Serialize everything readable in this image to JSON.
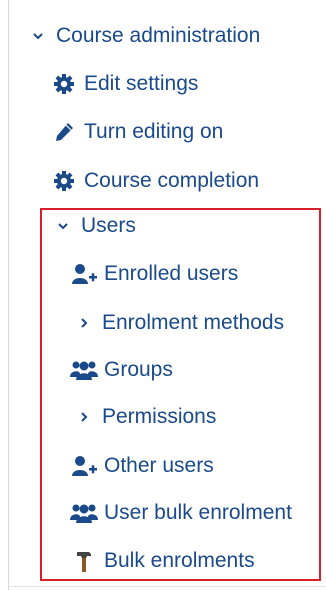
{
  "course_admin": {
    "label": "Course administration",
    "items": [
      {
        "label": "Edit settings",
        "icon": "gear-icon"
      },
      {
        "label": "Turn editing on",
        "icon": "pencil-icon"
      },
      {
        "label": "Course completion",
        "icon": "gear-icon"
      }
    ]
  },
  "users": {
    "label": "Users",
    "items": [
      {
        "label": "Enrolled users",
        "icon": "user-plus-icon"
      },
      {
        "label": "Enrolment methods",
        "icon": "chevron-right-icon"
      },
      {
        "label": "Groups",
        "icon": "users-icon"
      },
      {
        "label": "Permissions",
        "icon": "chevron-right-icon"
      },
      {
        "label": "Other users",
        "icon": "user-plus-icon"
      },
      {
        "label": "User bulk enrolment",
        "icon": "users-icon"
      },
      {
        "label": "Bulk enrolments",
        "icon": "hammer-icon"
      }
    ]
  },
  "colors": {
    "link": "#1a4a8a",
    "highlight": "#d8202a",
    "hammer_handle": "#8a5a2b"
  }
}
